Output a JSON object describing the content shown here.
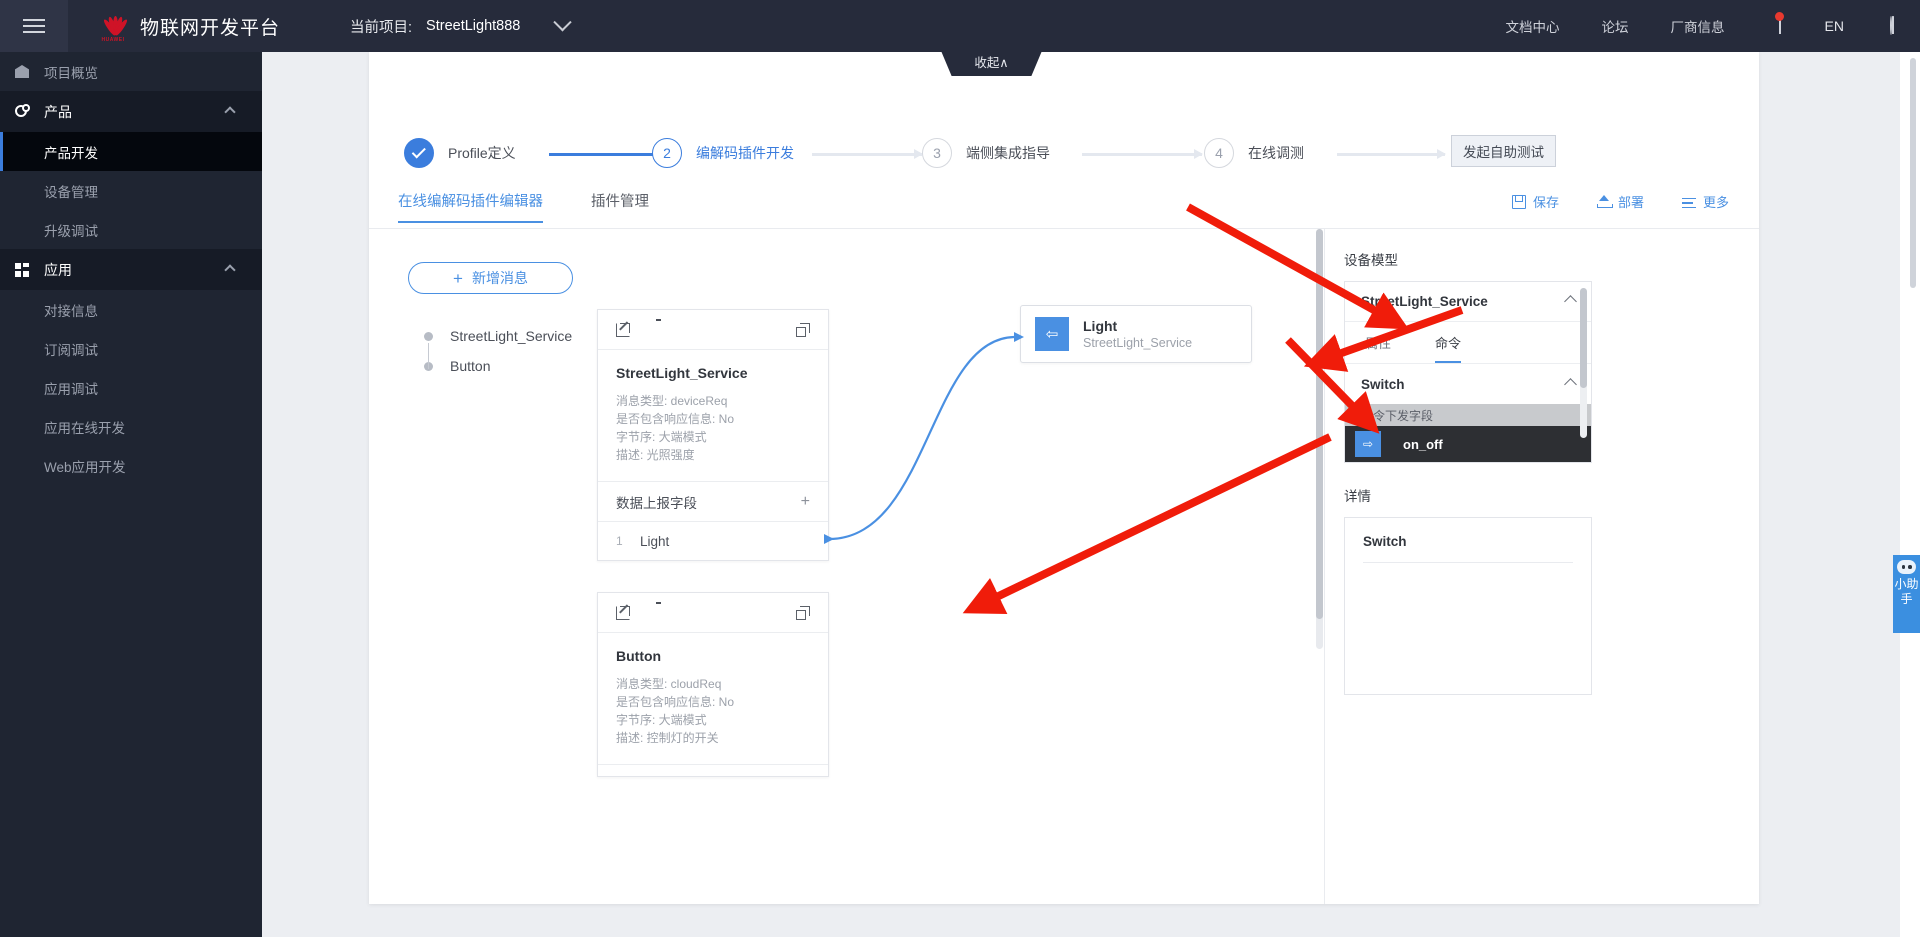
{
  "header": {
    "menu_icon": "hamburger-icon",
    "brand": "物联网开发平台",
    "brand_logo": "huawei-logo",
    "project_label": "当前项目:",
    "project_value": "StreetLight888",
    "links": [
      "文档中心",
      "论坛",
      "厂商信息"
    ],
    "notification_icon": "bell-icon",
    "language": "EN",
    "account_icon": "user-icon"
  },
  "sidebar": {
    "items": [
      {
        "label": "项目概览",
        "icon": "home-icon",
        "type": "item"
      },
      {
        "label": "产品",
        "icon": "product-icon",
        "type": "group",
        "expanded": true
      },
      {
        "label": "产品开发",
        "type": "sub",
        "active": true
      },
      {
        "label": "设备管理",
        "type": "sub"
      },
      {
        "label": "升级调试",
        "type": "sub"
      },
      {
        "label": "应用",
        "icon": "apps-icon",
        "type": "group",
        "expanded": true
      },
      {
        "label": "对接信息",
        "type": "sub"
      },
      {
        "label": "订阅调试",
        "type": "sub"
      },
      {
        "label": "应用调试",
        "type": "sub"
      },
      {
        "label": "应用在线开发",
        "type": "sub"
      },
      {
        "label": "Web应用开发",
        "type": "sub"
      }
    ]
  },
  "collapse_tab": {
    "label": "收起∧"
  },
  "stepper": {
    "steps": [
      {
        "num": "1",
        "label": "Profile定义",
        "state": "done"
      },
      {
        "num": "2",
        "label": "编解码插件开发",
        "state": "current"
      },
      {
        "num": "3",
        "label": "端侧集成指导",
        "state": "idle"
      },
      {
        "num": "4",
        "label": "在线调测",
        "state": "idle"
      }
    ],
    "selftest_button": "发起自助测试"
  },
  "tabs": {
    "items": [
      {
        "label": "在线编解码插件编辑器",
        "active": true
      },
      {
        "label": "插件管理",
        "active": false
      }
    ]
  },
  "toolbar": {
    "save_label": "保存",
    "save_icon": "save-icon",
    "deploy_label": "部署",
    "deploy_icon": "deploy-icon",
    "more_label": "更多",
    "more_icon": "more-icon"
  },
  "editor": {
    "add_message_button": "新增消息",
    "add_icon": "plus-icon",
    "tree": [
      {
        "label": "StreetLight_Service"
      },
      {
        "label": "Button"
      }
    ],
    "cards": [
      {
        "title": "StreetLight_Service",
        "meta": [
          "消息类型: deviceReq",
          "是否包含响应信息: No",
          "字节序: 大端模式",
          "描述: 光照强度"
        ],
        "section": "数据上报字段",
        "add_field_icon": "plus-icon",
        "rows": [
          {
            "index": "1",
            "name": "Light"
          }
        ]
      },
      {
        "title": "Button",
        "meta": [
          "消息类型: cloudReq",
          "是否包含响应信息: No",
          "字节序: 大端模式",
          "描述: 控制灯的开关"
        ]
      }
    ],
    "node": {
      "name": "Light",
      "subtitle": "StreetLight_Service",
      "icon": "data-mapping-icon"
    }
  },
  "right_panel": {
    "device_model_title": "设备模型",
    "service_name": "StreetLight_Service",
    "collapse_icon": "chevron-up-icon",
    "tabs": [
      {
        "label": "属性",
        "active": false
      },
      {
        "label": "命令",
        "active": true
      }
    ],
    "command_group": "Switch",
    "field_section": "命令下发字段",
    "field_item": {
      "name": "on_off",
      "icon": "data-mapping-icon"
    },
    "detail_title": "详情",
    "detail_name": "Switch"
  },
  "assistant": {
    "label": "小助手",
    "icon": "robot-icon"
  },
  "annotations": {
    "arrow_color": "#f01c0a",
    "arrows": [
      {
        "name": "arrow-to-command-tab"
      },
      {
        "name": "arrow-to-switch-group"
      },
      {
        "name": "arrow-to-on-off-field"
      },
      {
        "name": "arrow-to-canvas"
      }
    ]
  }
}
